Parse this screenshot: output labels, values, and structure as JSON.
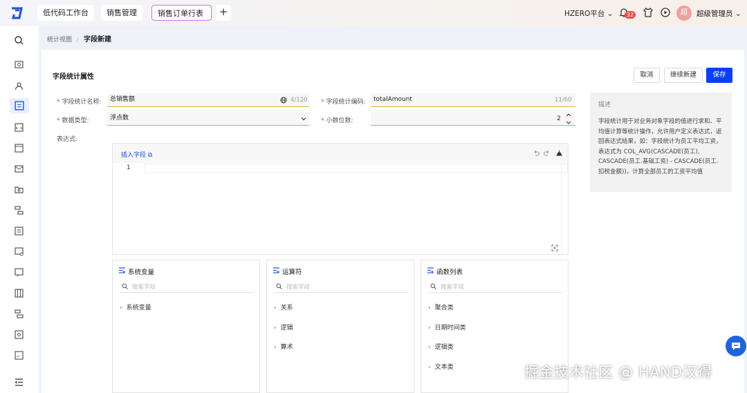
{
  "header": {
    "tabs": [
      "低代码工作台",
      "销售管理",
      "销售订单行表"
    ],
    "platform": "HZERO平台",
    "notification_count": "32",
    "avatar_text": "超",
    "user_name": "超级管理员"
  },
  "breadcrumb": {
    "parent": "统计视图",
    "separator": "/",
    "current": "字段新建"
  },
  "form": {
    "section_title": "字段统计属性",
    "buttons": {
      "cancel": "取消",
      "continue": "继续新建",
      "save": "保存"
    },
    "name_label": "字段统计名称:",
    "name_value": "总销售额",
    "name_count": "4/120",
    "code_label": "字段统计编码:",
    "code_value": "totalAmount",
    "code_count": "11/60",
    "type_label": "数据类型:",
    "type_value": "浮点数",
    "decimal_label": "小数位数:",
    "decimal_value": "2",
    "expression_label": "表达式:"
  },
  "description": {
    "title": "描述",
    "body": "字段统计用于对业务对象字段的值进行求和、平均值计算等统计操作，允许用户定义表达式，返回表达式结果，如：字段统计为员工平均工资，表达式为 COL_AVG(CASCADE(员工), CASCADE(员工.基础工资) - CASCADE(员工.扣税金额))，计算全部员工的工资平均值"
  },
  "editor": {
    "insert_label": "插入字段",
    "line_number": "1"
  },
  "panels": [
    {
      "title": "系统变量",
      "placeholder": "搜索字段",
      "items": [
        "系统变量"
      ]
    },
    {
      "title": "运算符",
      "placeholder": "搜索字段",
      "items": [
        "关系",
        "逻辑",
        "算术"
      ]
    },
    {
      "title": "函数列表",
      "placeholder": "搜索字段",
      "items": [
        "聚合类",
        "日期时间类",
        "逻辑类",
        "文本类"
      ]
    }
  ],
  "watermark": "掘金技术社区 @ HAND汉得",
  "colors": {
    "primary": "#0840f8",
    "required": "#e2483c",
    "field_underline": "#e6a93c",
    "link": "#2456d8"
  }
}
